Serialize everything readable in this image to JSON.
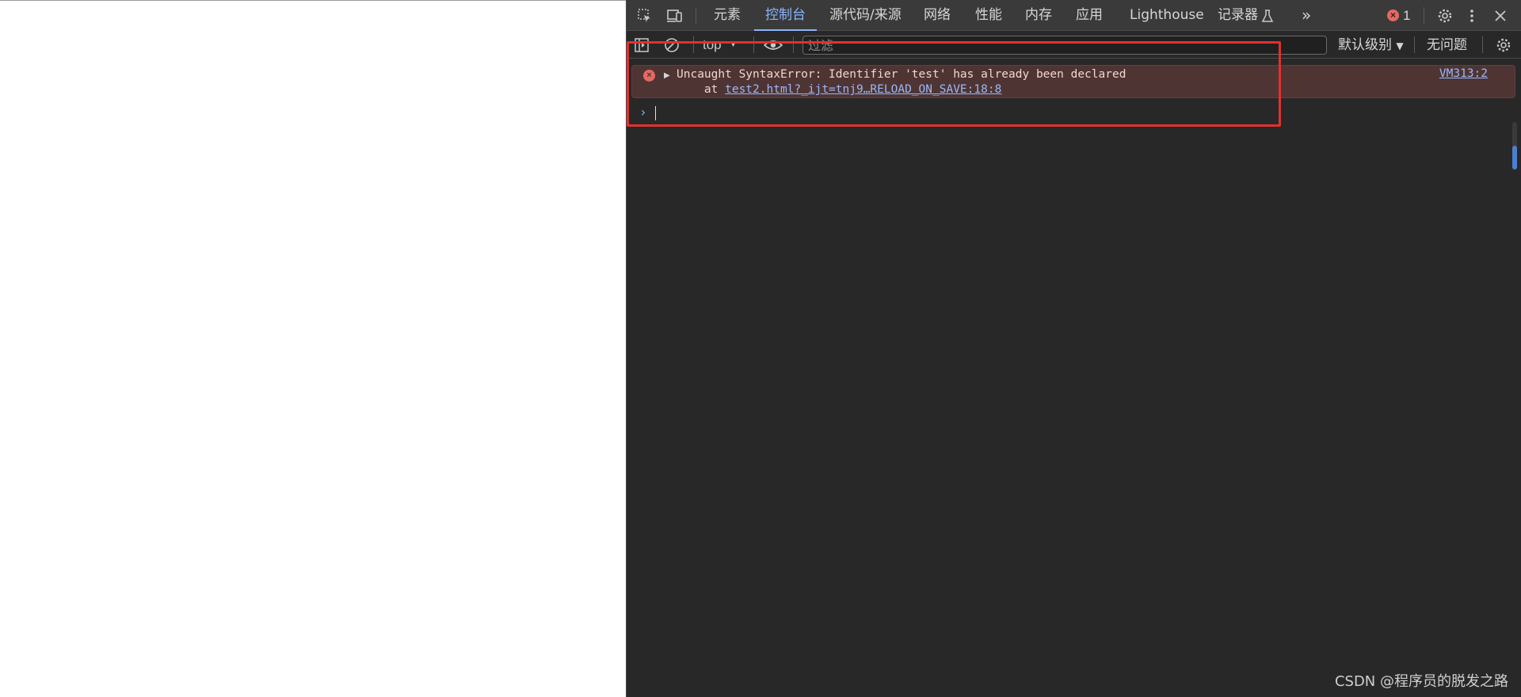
{
  "devtools": {
    "tabs": [
      {
        "label": "元素"
      },
      {
        "label": "控制台"
      },
      {
        "label": "源代码/来源"
      },
      {
        "label": "网络"
      },
      {
        "label": "性能"
      },
      {
        "label": "内存"
      },
      {
        "label": "应用"
      },
      {
        "label": "Lighthouse"
      },
      {
        "label": "记录器"
      }
    ],
    "active_tab": "控制台",
    "error_count": "1",
    "more_tabs": "»"
  },
  "toolbar": {
    "context": "top",
    "filter_placeholder": "过滤",
    "level_select": "默认级别",
    "issues": "无问题"
  },
  "console": {
    "error_message": "Uncaught SyntaxError: Identifier 'test' has already been declared",
    "error_at": "    at ",
    "error_link": "test2.html?_ijt=tnj9…RELOAD_ON_SAVE:18:8",
    "source_link": "VM313:2",
    "error_icon": "×"
  },
  "colors": {
    "accent": "#8ab4f8",
    "error_bg": "#4e3534",
    "error_icon": "#e46962",
    "annotation_box": "#e0312e"
  },
  "watermark": "CSDN @程序员的脱发之路"
}
